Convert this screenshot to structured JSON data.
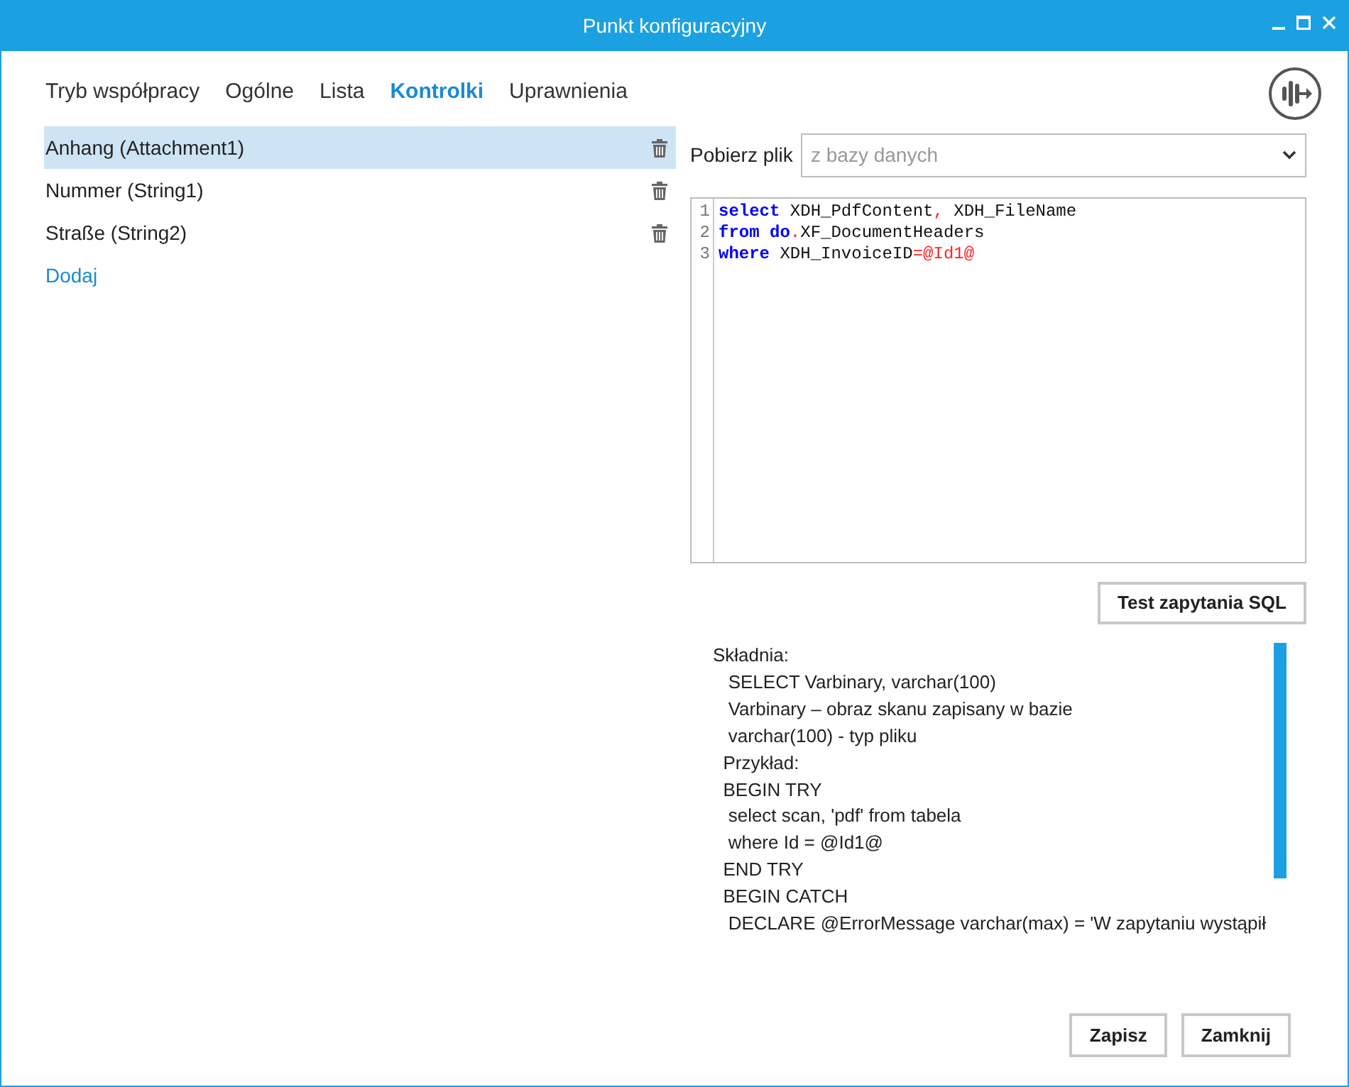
{
  "window": {
    "title": "Punkt konfiguracyjny"
  },
  "tabs": [
    {
      "label": "Tryb współpracy",
      "selected": false
    },
    {
      "label": "Ogólne",
      "selected": false
    },
    {
      "label": "Lista",
      "selected": false
    },
    {
      "label": "Kontrolki",
      "selected": true
    },
    {
      "label": "Uprawnienia",
      "selected": false
    }
  ],
  "controls": {
    "items": [
      {
        "label": "Anhang (Attachment1)",
        "selected": true
      },
      {
        "label": "Nummer (String1)",
        "selected": false
      },
      {
        "label": "Straße (String2)",
        "selected": false
      }
    ],
    "add_link": "Dodaj"
  },
  "source": {
    "label": "Pobierz plik",
    "value": "z bazy danych"
  },
  "editor": {
    "lines": [
      {
        "number": "1",
        "tokens": [
          {
            "kind": "keyword",
            "text": "select"
          },
          {
            "kind": "plain",
            "text": " XDH_PdfContent"
          },
          {
            "kind": "operator",
            "text": ","
          },
          {
            "kind": "plain",
            "text": " XDH_FileName"
          }
        ]
      },
      {
        "number": "2",
        "tokens": [
          {
            "kind": "keyword",
            "text": "from"
          },
          {
            "kind": "keyword",
            "text": " do"
          },
          {
            "kind": "operator",
            "text": "."
          },
          {
            "kind": "plain",
            "text": "XF_DocumentHeaders"
          }
        ]
      },
      {
        "number": "3",
        "tokens": [
          {
            "kind": "keyword",
            "text": "where"
          },
          {
            "kind": "plain",
            "text": " XDH_InvoiceID"
          },
          {
            "kind": "operator",
            "text": "="
          },
          {
            "kind": "operator",
            "text": "@Id1@"
          }
        ]
      }
    ]
  },
  "test_button": "Test zapytania SQL",
  "help_lines": [
    "Składnia:",
    "   SELECT Varbinary, varchar(100)",
    "   Varbinary – obraz skanu zapisany w bazie",
    "   varchar(100) - typ pliku",
    "  Przykład:",
    "  BEGIN TRY",
    "   select scan, 'pdf' from tabela",
    "   where Id = @Id1@",
    "  END TRY",
    "  BEGIN CATCH",
    "   DECLARE @ErrorMessage varchar(max) = 'W zapytaniu wystąpił"
  ],
  "buttons": [
    "Zapisz",
    "Zamknij"
  ]
}
